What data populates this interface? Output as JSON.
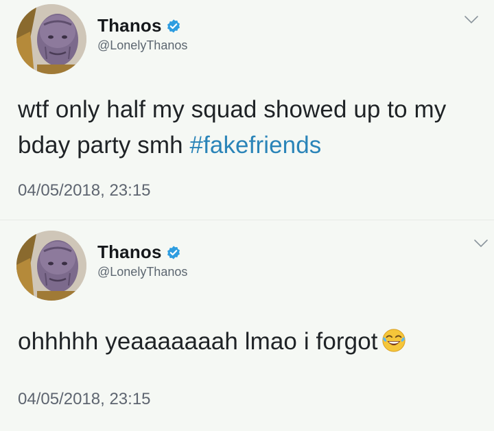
{
  "colors": {
    "background": "#f5f8f4",
    "text": "#1f2326",
    "muted": "#5e6570",
    "hashtag": "#2a84b8",
    "verified": "#2e9de0"
  },
  "icons": {
    "verified": "verified-badge-icon",
    "more": "chevron-down-icon",
    "emoji": "face-with-tears-of-joy-emoji"
  },
  "tweets": [
    {
      "display_name": "Thanos",
      "handle": "@LonelyThanos",
      "text_main": "wtf only half my squad showed up to my bday party smh ",
      "hashtag": "#fakefriends",
      "timestamp": "04/05/2018, 23:15"
    },
    {
      "display_name": "Thanos",
      "handle": "@LonelyThanos",
      "text_main": "ohhhhh yeaaaaaaah lmao i forgot",
      "timestamp": "04/05/2018, 23:15"
    }
  ]
}
